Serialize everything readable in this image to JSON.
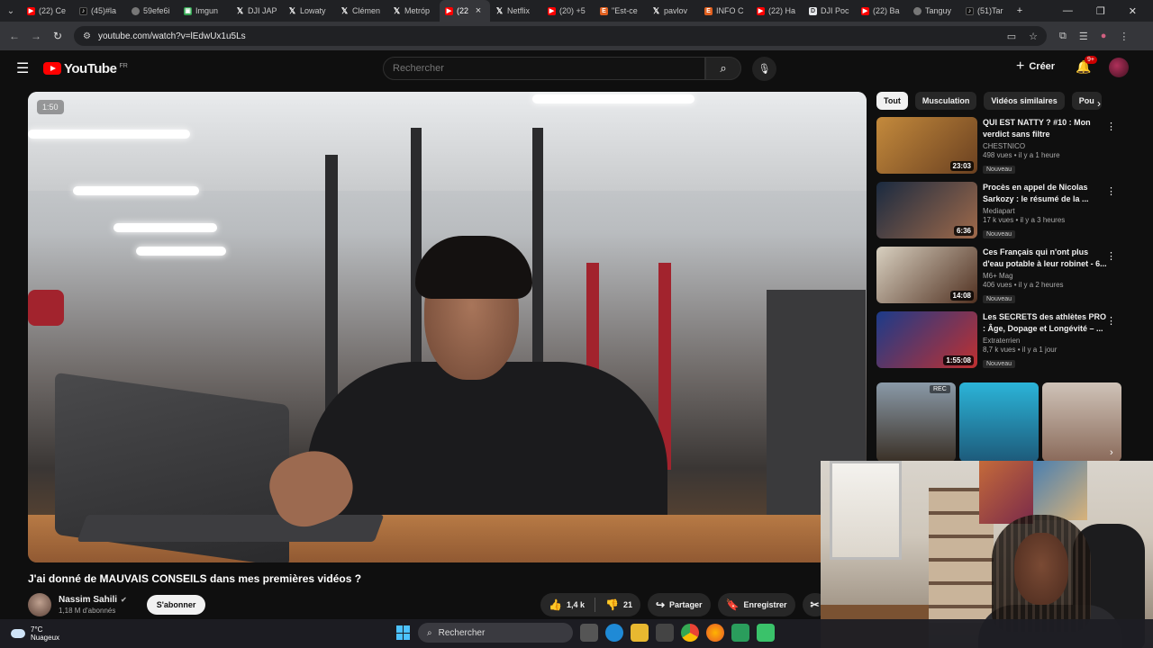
{
  "browser": {
    "tabs": [
      {
        "label": "(22) Ce",
        "icon": "yt"
      },
      {
        "label": "(45)#la",
        "icon": "tt"
      },
      {
        "label": "59efe6i",
        "icon": "web"
      },
      {
        "label": "Imgun",
        "icon": "g"
      },
      {
        "label": "DJI JAP",
        "icon": "x"
      },
      {
        "label": "Lowaty",
        "icon": "x"
      },
      {
        "label": "Clémen",
        "icon": "x"
      },
      {
        "label": "Metróp",
        "icon": "x"
      },
      {
        "label": "(22",
        "icon": "yt",
        "active": true
      },
      {
        "label": "Netflix",
        "icon": "x"
      },
      {
        "label": "(20) +5",
        "icon": "yt"
      },
      {
        "label": "\"Est-ce",
        "icon": "or"
      },
      {
        "label": "pavlov",
        "icon": "x"
      },
      {
        "label": "INFO C",
        "icon": "or"
      },
      {
        "label": "(22) Ha",
        "icon": "yt"
      },
      {
        "label": "DJI Poc",
        "icon": "doc"
      },
      {
        "label": "(22) Ba",
        "icon": "yt"
      },
      {
        "label": "Tanguy",
        "icon": "web"
      },
      {
        "label": "(51)Tar",
        "icon": "tt"
      }
    ],
    "url": "youtube.com/watch?v=lEdwUx1u5Ls"
  },
  "youtube": {
    "logo": "YouTube",
    "region": "FR",
    "search_placeholder": "Rechercher",
    "create_label": "Créer",
    "notif_count": "9+",
    "video": {
      "time": "1:50",
      "title": "J'ai donné de MAUVAIS CONSEILS dans mes premières vidéos ?",
      "channel": "Nassim Sahili",
      "subscribers": "1,18 M d'abonnés",
      "subscribe_label": "S'abonner",
      "likes": "1,4 k",
      "dislikes": "21",
      "share_label": "Partager",
      "save_label": "Enregistrer"
    },
    "chips": [
      "Tout",
      "Musculation",
      "Vidéos similaires",
      "Pou"
    ],
    "recommendations": [
      {
        "title": "QUI EST NATTY ? #10 : Mon verdict sans filtre",
        "channel": "CHESTNICO",
        "meta": "498 vues • il y a 1 heure",
        "badge": "Nouveau",
        "duration": "23:03"
      },
      {
        "title": "Procès en appel de Nicolas Sarkozy : le résumé de la ...",
        "channel": "Mediapart",
        "meta": "17 k vues • il y a 3 heures",
        "badge": "Nouveau",
        "duration": "6:36"
      },
      {
        "title": "Ces Français qui n'ont plus d'eau potable à leur robinet - 6...",
        "channel": "M6+ Mag",
        "meta": "406 vues • il y a 2 heures",
        "badge": "Nouveau",
        "duration": "14:08"
      },
      {
        "title": "Les SECRETS des athlètes PRO : Âge, Dopage et Longévité – ...",
        "channel": "Extraterrien",
        "meta": "8,7 k vues • il y a 1 jour",
        "badge": "Nouveau",
        "duration": "1:55:08"
      }
    ],
    "shorts_tag": "REC"
  },
  "taskbar": {
    "temp": "7°C",
    "weather": "Nuageux",
    "search_label": "Rechercher"
  }
}
